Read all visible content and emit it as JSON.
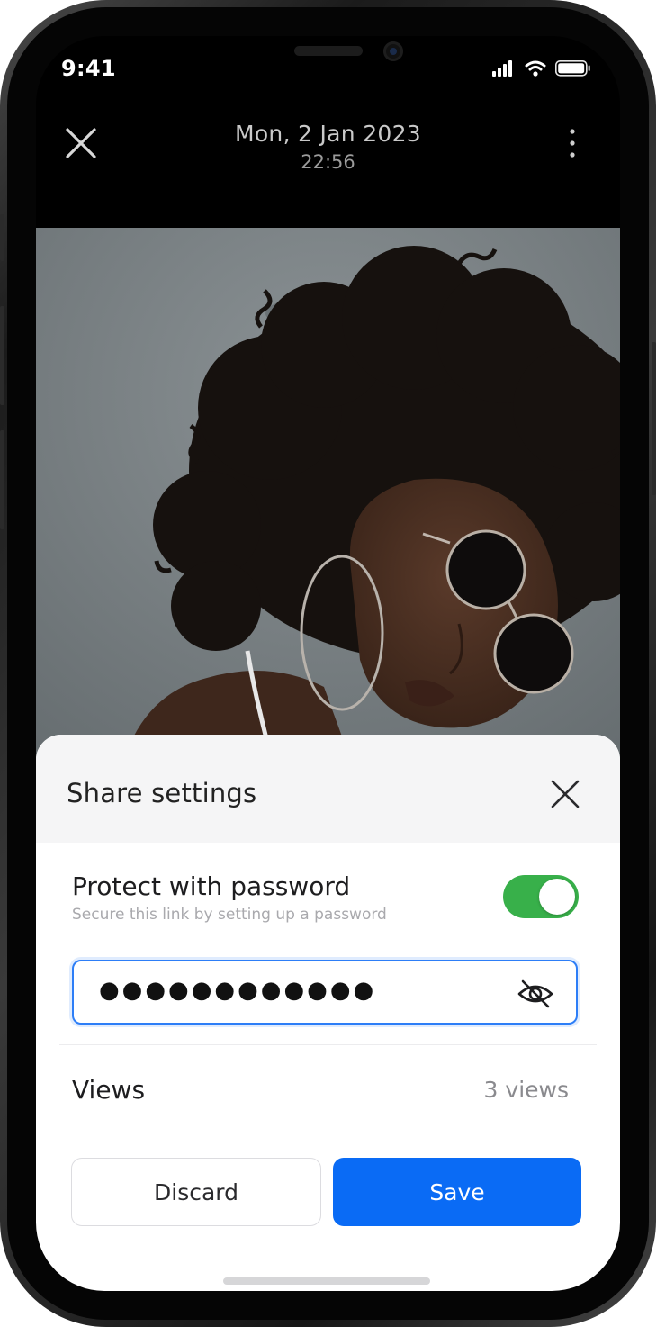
{
  "status_bar": {
    "time": "9:41"
  },
  "header": {
    "date": "Mon, 2 Jan 2023",
    "time": "22:56",
    "close_icon": "close-icon",
    "more_icon": "more-vertical-icon"
  },
  "share_settings": {
    "title": "Share settings",
    "protect_label": "Protect with password",
    "protect_sub": "Secure this link by setting up a password",
    "protect_enabled": true,
    "password_masked": "●●●●●●●●●●●●",
    "views_label": "Views",
    "views_value": "3 views",
    "discard_label": "Discard",
    "save_label": "Save"
  },
  "colors": {
    "toggle_on": "#38b04a",
    "accent": "#0a6bf5",
    "field_focus": "#2d7ef7"
  }
}
